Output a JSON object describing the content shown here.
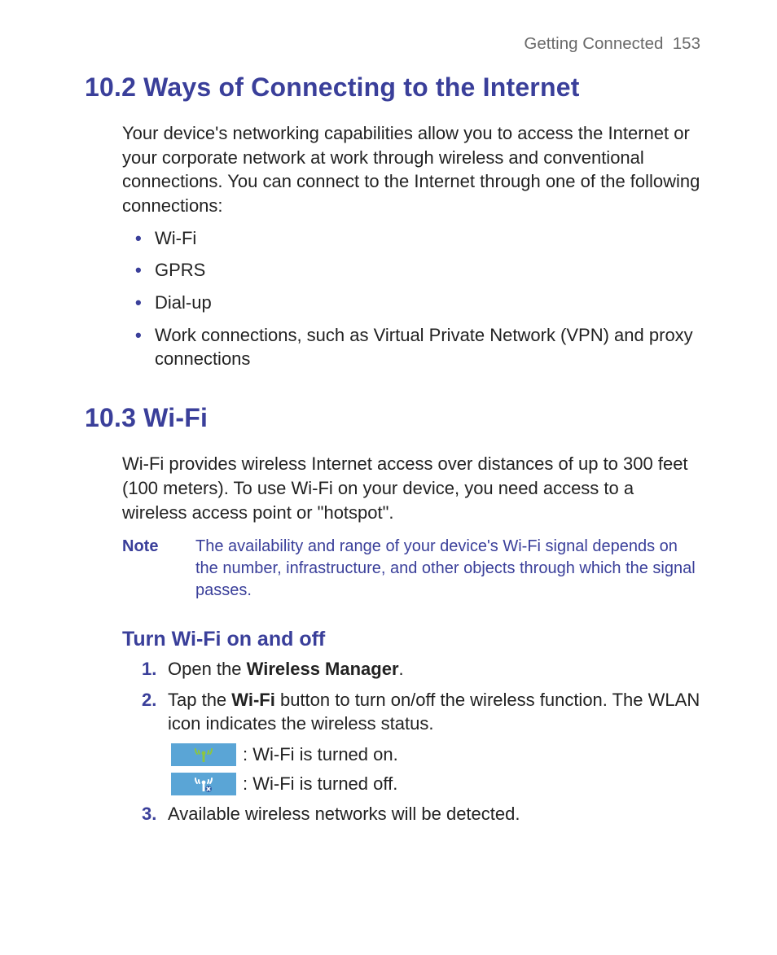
{
  "header": {
    "chapter_title": "Getting Connected",
    "page_number": "153"
  },
  "section_10_2": {
    "heading": "10.2  Ways of Connecting to the Internet",
    "intro": "Your device's networking capabilities allow you to access the Internet or your corporate network at work through wireless and conventional connections. You can connect to the Internet through one of the following connections:",
    "bullets": [
      "Wi-Fi",
      "GPRS",
      "Dial-up",
      "Work connections, such as Virtual Private Network (VPN) and proxy connections"
    ]
  },
  "section_10_3": {
    "heading": "10.3  Wi-Fi",
    "intro": "Wi-Fi provides wireless Internet access over distances of up to 300 feet (100 meters). To use Wi-Fi on your device, you need access to a wireless access point or \"hotspot\".",
    "note_label": "Note",
    "note_text": "The availability and range of your device's Wi-Fi signal depends on the number, infrastructure, and other objects through which the signal passes.",
    "subheading": "Turn Wi-Fi on and off",
    "steps": {
      "s1_a": "Open the ",
      "s1_bold": "Wireless Manager",
      "s1_b": ".",
      "s2_a": "Tap the ",
      "s2_bold": "Wi-Fi",
      "s2_b": " button to turn on/off the wireless function. The WLAN icon indicates the wireless status.",
      "status_on": " : Wi-Fi is turned on.",
      "status_off": " : Wi-Fi is turned off.",
      "s3": "Available wireless networks will be detected."
    }
  },
  "colors": {
    "accent": "#3a3f9a",
    "chip_bg": "#5aa5d6",
    "icon_on": "#8dc63f",
    "icon_off": "#ffffff",
    "header_grey": "#6a6a6a"
  }
}
